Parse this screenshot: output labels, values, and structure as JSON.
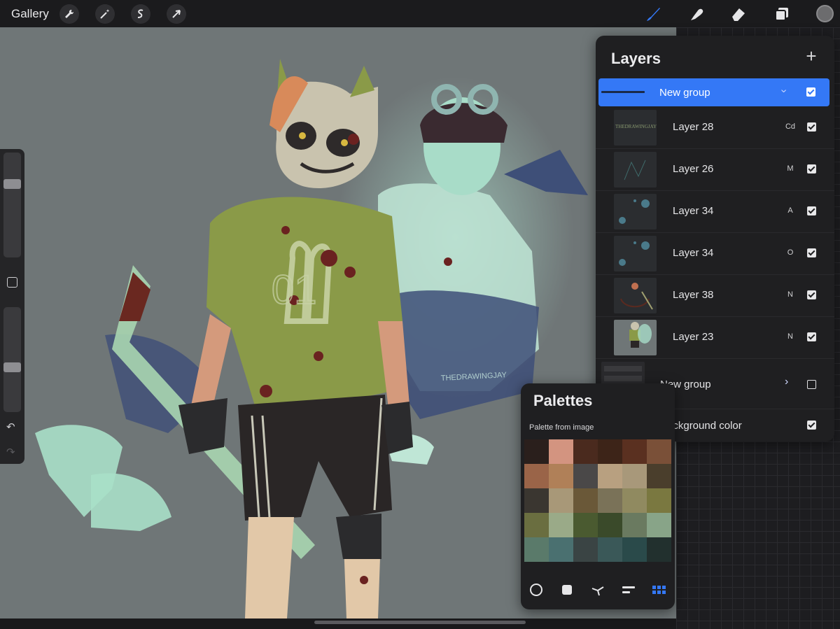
{
  "topbar": {
    "gallery_label": "Gallery",
    "left_tools": [
      "wrench-icon",
      "magic-wand-icon",
      "selection-icon",
      "transform-arrow-icon"
    ],
    "right_tools": [
      "brush-icon",
      "smudge-icon",
      "eraser-icon",
      "layers-icon"
    ],
    "active_tool": "brush-icon",
    "accent_color": "#3478f6",
    "current_color": "#6c6c6e"
  },
  "canvas": {
    "watermark": "THEDRAWINGJAY",
    "jersey_number": "01"
  },
  "sidebar": {
    "brush_size_level": 0.72,
    "opacity_level": 0.42
  },
  "layers": {
    "title": "Layers",
    "add_label": "+",
    "rows": [
      {
        "name": "New group",
        "blend": "",
        "visible": true,
        "selected": true,
        "type": "group"
      },
      {
        "name": "Layer 28",
        "blend": "Cd",
        "visible": true,
        "thumb_text": "THEDRAWINGJAY"
      },
      {
        "name": "Layer 26",
        "blend": "M",
        "visible": true
      },
      {
        "name": "Layer 34",
        "blend": "A",
        "visible": true
      },
      {
        "name": "Layer 34",
        "blend": "O",
        "visible": true
      },
      {
        "name": "Layer 38",
        "blend": "N",
        "visible": true
      },
      {
        "name": "Layer 23",
        "blend": "N",
        "visible": true
      },
      {
        "name": "New group",
        "blend": "",
        "visible": false,
        "type": "group-collapsed"
      },
      {
        "name": "Background color",
        "blend": "",
        "visible": true,
        "type": "background",
        "color": "#c9bfbc"
      }
    ]
  },
  "palettes": {
    "title": "Palettes",
    "subtitle": "Palette from image",
    "swatches": [
      "#2a1f1c",
      "#d39480",
      "#4a2a1e",
      "#3d2418",
      "#5a3020",
      "#7a5038",
      "#9a6448",
      "#b08058",
      "#4a4848",
      "#b8a080",
      "#a8987a",
      "#4a3e2c",
      "#3a3630",
      "#a89878",
      "#6a5838",
      "#7a7258",
      "#908a60",
      "#7a7840",
      "#6a6e40",
      "#9aaa88",
      "#4a5a30",
      "#3a4a2a",
      "#6a7a60",
      "#88a488",
      "#5a7a6a",
      "#4a7070",
      "#3a4444",
      "#3a5858",
      "#2a4a4a",
      "#22302e"
    ],
    "view_icons": [
      "disc-icon",
      "classic-square-icon",
      "harmony-icon",
      "value-sliders-icon",
      "palette-grid-icon"
    ],
    "active_view": "palette-grid-icon"
  }
}
